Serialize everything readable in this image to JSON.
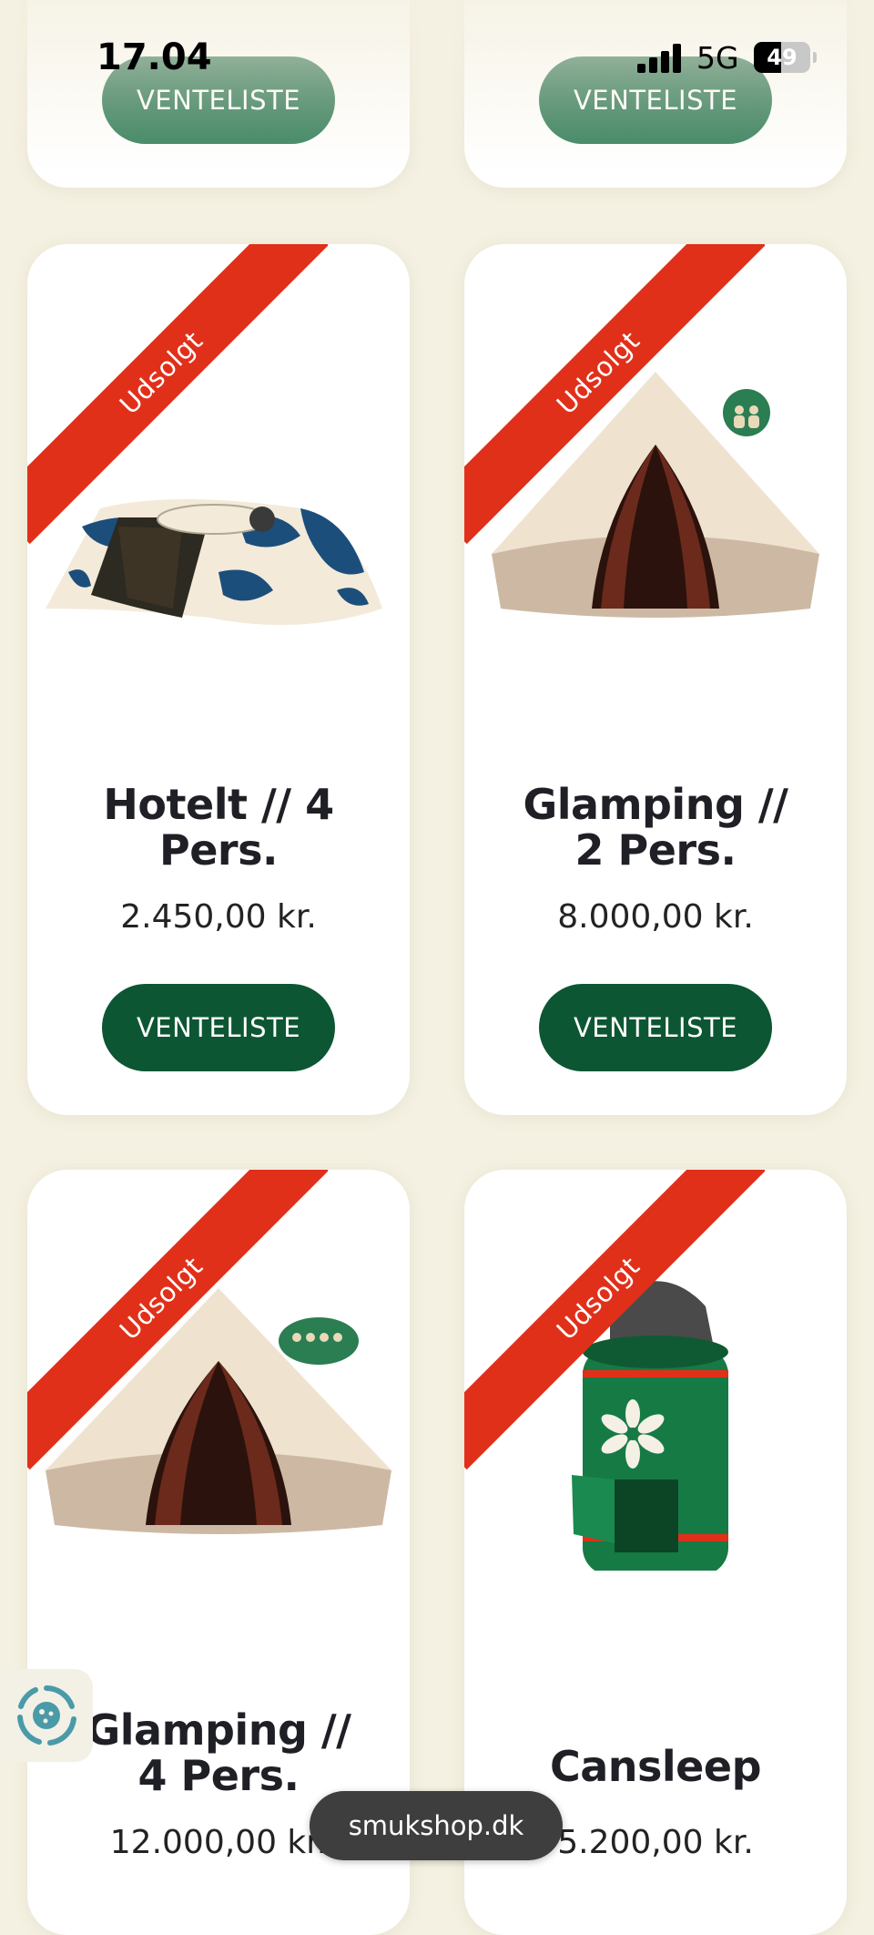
{
  "status_bar": {
    "time": "17.04",
    "network": "5G",
    "battery": "49",
    "battery_level": 0.49
  },
  "top_row": {
    "left": {
      "button_label": "VENTELISTE"
    },
    "right": {
      "button_label": "VENTELISTE"
    }
  },
  "products": [
    {
      "title_line1": "Hotelt // 4",
      "title_line2": "Pers.",
      "price": "2.450,00 kr.",
      "badge": "Udsolgt",
      "button_label": "VENTELISTE",
      "illustration": "camo-tent"
    },
    {
      "title_line1": "Glamping //",
      "title_line2": "2 Pers.",
      "price": "8.000,00 kr.",
      "badge": "Udsolgt",
      "button_label": "VENTELISTE",
      "illustration": "bell-tent-2-person"
    },
    {
      "title_line1": "Glamping //",
      "title_line2": "4 Pers.",
      "price": "12.000,00 kr.",
      "badge": "Udsolgt",
      "illustration": "bell-tent-4-person"
    },
    {
      "title_line1": "Cansleep",
      "title_line2": "",
      "price": "5.200,00 kr.",
      "badge": "Udsolgt",
      "illustration": "cansleep-can-tent"
    }
  ],
  "browser": {
    "url": "smukshop.dk"
  },
  "colors": {
    "background": "#f5f1e2",
    "button": "#0d5633",
    "ribbon": "#e1301a",
    "text": "#1f1f26"
  }
}
